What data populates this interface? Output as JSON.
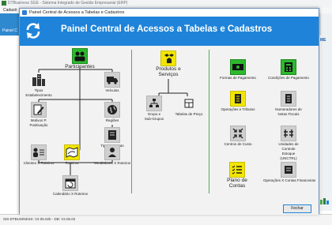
{
  "app": {
    "title": "DTBusiness SGE - Sistema Integrado de Gestão Empresarial (ERP)",
    "menu_first": "Cadastr",
    "tab_label": "Painel C",
    "right_badge": "ME",
    "status_text": "SIS-DTBUSINESS: V2.05.02b - DB: V2.05.02"
  },
  "dialog": {
    "window_title": "Painel Central de Acessos a Tabelas e Cadastros",
    "header_title": "Painel Central de Acessos a Tabelas e Cadastros",
    "close_label": "Fechar"
  },
  "section1": {
    "participantes": "Participantes",
    "tipos_estab": [
      "Tipos",
      "Estabelecimento"
    ],
    "veiculos": "Veículos",
    "motivos": [
      "Motivos P.",
      "Positivação"
    ],
    "regioes": "Regiões",
    "tipos_contrato": "Tipos Contrato",
    "clientes_roteiros": "Clientes X Roteiros",
    "roteiros": "Roteiros",
    "vendedores_roteiros": "Vendedores X Roteiros",
    "calendario": "Calendário X Roteiros"
  },
  "section2": {
    "produtos": [
      "Produtos e",
      "Serviços"
    ],
    "grupos": [
      "Grupo e",
      "Sub-Grupos"
    ],
    "tabelas_preco": "Tabelas de Preço"
  },
  "section3": {
    "formas_pagamento": "Formas de Pagamento",
    "condicoes_pagamento": "Condições de Pagamento",
    "operacoes_tributos": "Operações e Tributos",
    "numeradores": [
      "Numeradores de",
      "Notas Fiscais"
    ],
    "centros_custo": "Centros de Custo",
    "unidades_controle": [
      "Unidades de",
      "Controle",
      "Estoque",
      "(UNCTRL)"
    ],
    "plano_contas": [
      "Plano de",
      "Contas"
    ],
    "operacoes_contas": "Operações X Contas Financeiras"
  },
  "colors": {
    "header_blue": "#1f84d9",
    "green_tile": "#2eb82e",
    "yellow_tile": "#f2e600",
    "divider_green": "#4caf50"
  }
}
